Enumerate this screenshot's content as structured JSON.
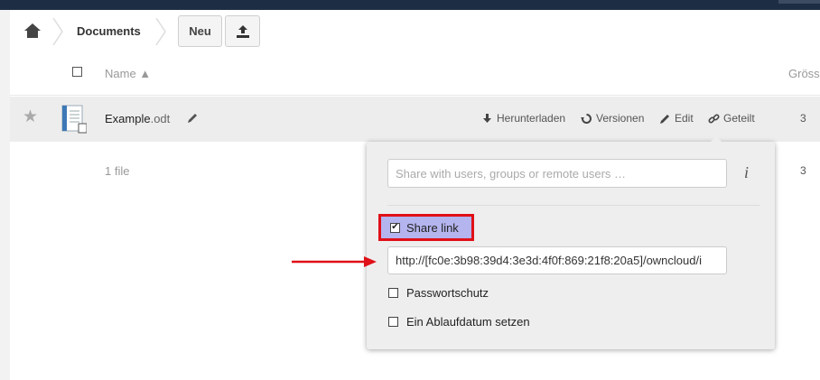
{
  "breadcrumb": {
    "home_icon": "home-icon",
    "folder": "Documents"
  },
  "toolbar": {
    "new_label": "Neu",
    "upload_icon": "upload-icon"
  },
  "table": {
    "header_name": "Name ▲",
    "header_size": "Gröss",
    "select_all_icon": "checkbox-icon"
  },
  "file": {
    "name": "Example",
    "extension": ".odt",
    "size_partial": "3",
    "actions": [
      {
        "label": "Herunterladen",
        "icon": "download-icon"
      },
      {
        "label": "Versionen",
        "icon": "history-icon"
      },
      {
        "label": "Edit",
        "icon": "pencil-icon"
      },
      {
        "label": "Geteilt",
        "icon": "link-icon"
      }
    ]
  },
  "summary": {
    "count": "1 file",
    "size_partial": "3"
  },
  "share_panel": {
    "search_placeholder": "Share with users, groups or remote users …",
    "info_icon": "i",
    "share_link_label": "Share link",
    "share_link_checked": true,
    "link_url": "http://[fc0e:3b98:39d4:3e3d:4f0f:869:21f8:20a5]/owncloud/i",
    "password_label": "Passwortschutz",
    "expiry_label": "Ein Ablaufdatum setzen"
  },
  "colors": {
    "topbar": "#1d2d44",
    "highlight_border": "#e01018",
    "highlight_fill": "#b4b4ee",
    "annotation_arrow": "#e01018"
  }
}
